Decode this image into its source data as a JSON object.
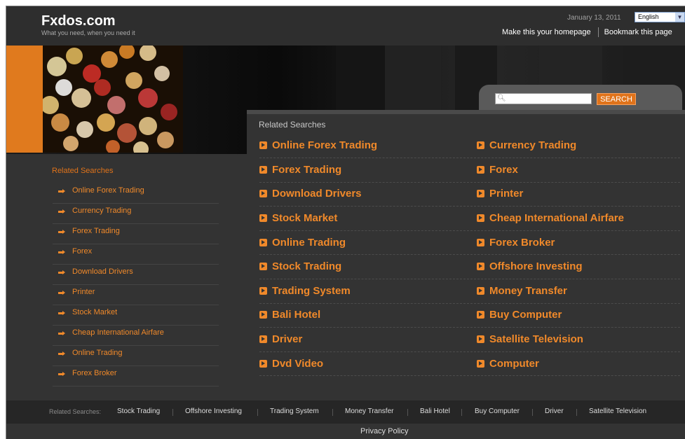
{
  "header": {
    "site_name": "Fxdos.com",
    "tagline": "What you need, when you need it",
    "date": "January 13, 2011",
    "language": "English",
    "make_homepage": "Make this your homepage",
    "bookmark": "Bookmark this page"
  },
  "search": {
    "placeholder": "",
    "button": "SEARCH"
  },
  "main": {
    "title": "Related Searches",
    "left_links": [
      "Online Forex Trading",
      "Forex Trading",
      "Download Drivers",
      "Stock Market",
      "Online Trading",
      "Stock Trading",
      "Trading System",
      "Bali Hotel",
      "Driver",
      "Dvd Video"
    ],
    "right_links": [
      "Currency Trading",
      "Forex",
      "Printer",
      "Cheap International Airfare",
      "Forex Broker",
      "Offshore Investing",
      "Money Transfer",
      "Buy Computer",
      "Satellite Television",
      "Computer"
    ]
  },
  "sidebar": {
    "title": "Related Searches",
    "items": [
      "Online Forex Trading",
      "Currency Trading",
      "Forex Trading",
      "Forex",
      "Download Drivers",
      "Printer",
      "Stock Market",
      "Cheap International Airfare",
      "Online Trading",
      "Forex Broker"
    ]
  },
  "footer": {
    "label": "Related Searches:",
    "links": [
      "Stock Trading",
      "Offshore Investing",
      "Trading System",
      "Money Transfer",
      "Bali Hotel",
      "Buy Computer",
      "Driver",
      "Satellite Television"
    ],
    "privacy": "Privacy Policy"
  },
  "colors": {
    "accent": "#f0892a",
    "background": "#333333",
    "orange_bar": "#e07a1e"
  },
  "icons": {
    "search": "magnifier-icon",
    "bullet": "orange-arrow-box-icon",
    "side_bullet": "orange-arrow-icon"
  }
}
